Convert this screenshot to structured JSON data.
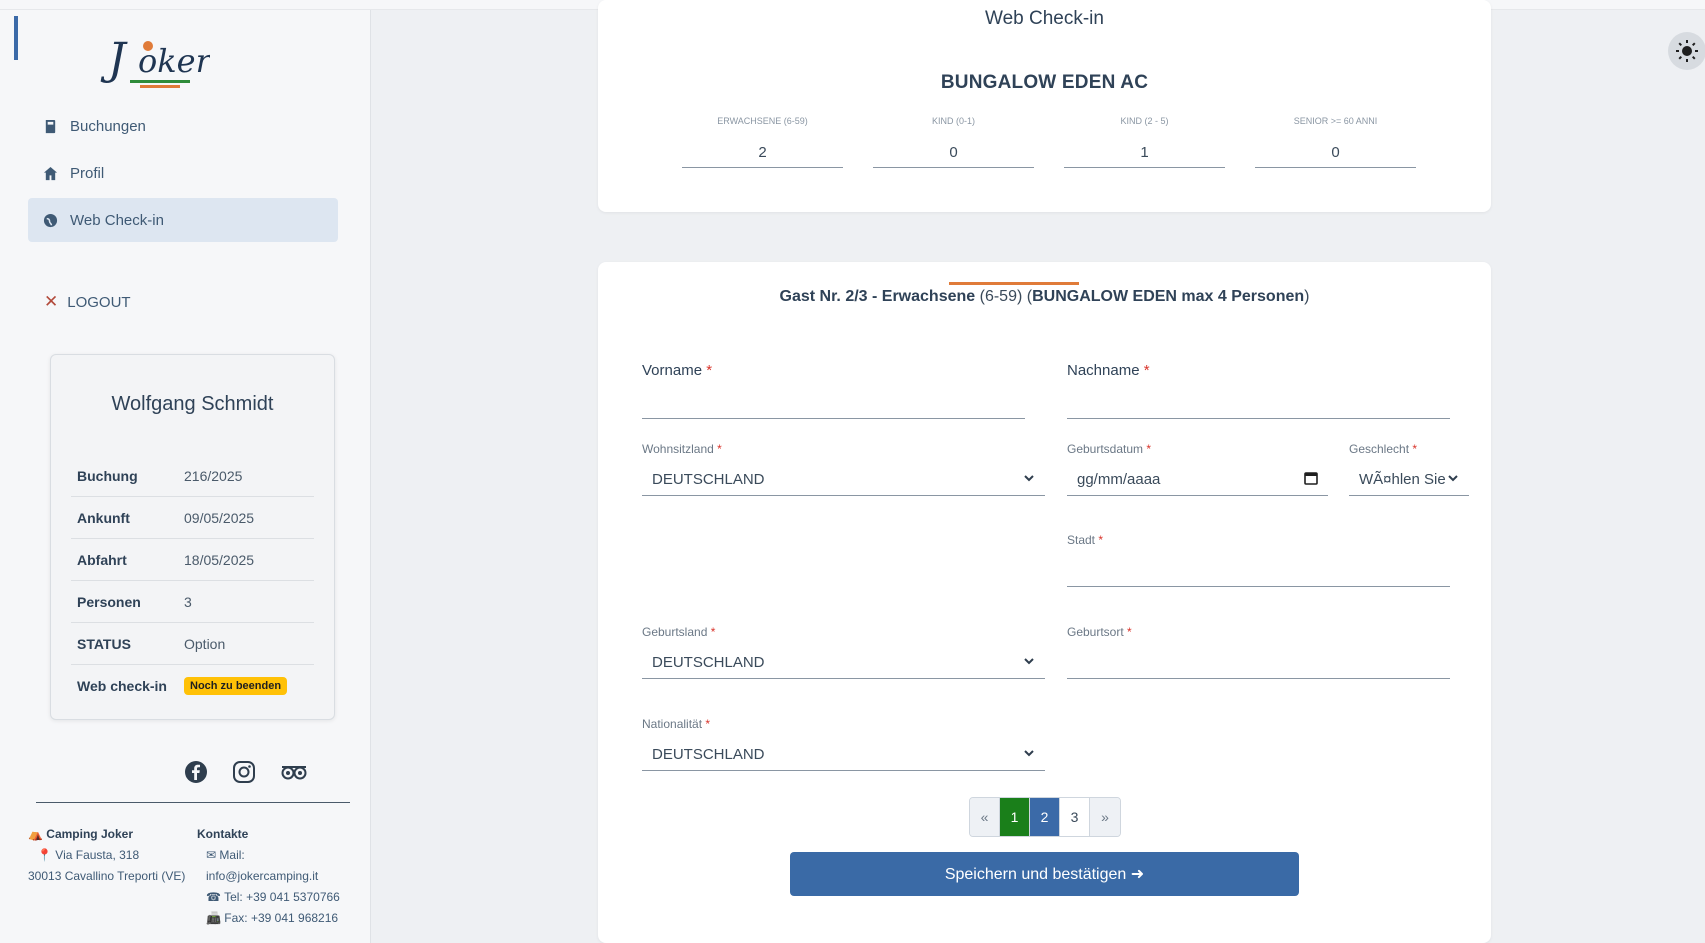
{
  "sidebar": {
    "nav": [
      {
        "label": "Buchungen",
        "icon": "book-icon"
      },
      {
        "label": "Profil",
        "icon": "home-icon"
      },
      {
        "label": "Web Check-in",
        "icon": "globe-icon",
        "active": true
      }
    ],
    "logout": "LOGOUT",
    "guest": {
      "name": "Wolfgang Schmidt",
      "rows": [
        {
          "key": "Buchung",
          "value": "216/2025"
        },
        {
          "key": "Ankunft",
          "value": "09/05/2025"
        },
        {
          "key": "Abfahrt",
          "value": "18/05/2025"
        },
        {
          "key": "Personen",
          "value": "3"
        },
        {
          "key": "STATUS",
          "value": "Option"
        },
        {
          "key": "Web check-in",
          "badge": "Noch zu beenden"
        }
      ]
    },
    "footer": {
      "company": "Camping Joker",
      "address1": "Via Fausta, 318",
      "address2": "30013 Cavallino Treporti (VE)",
      "contacts_title": "Kontakte",
      "mail_label": "Mail:",
      "mail": "info@jokercamping.it",
      "tel": "Tel: +39 041 5370766",
      "fax": "Fax: +39 041 968216"
    }
  },
  "main": {
    "header_title": "Web Check-in",
    "unit": "BUNGALOW EDEN AC",
    "counters": [
      {
        "label": "ERWACHSENE (6-59)",
        "value": "2"
      },
      {
        "label": "KIND (0-1)",
        "value": "0"
      },
      {
        "label": "KIND (2 - 5)",
        "value": "1"
      },
      {
        "label": "SENIOR >= 60 ANNI",
        "value": "0"
      }
    ],
    "form": {
      "title_part1": "Gast Nr. 2/3 - Erwachsene",
      "title_part2": "(6-59)",
      "title_part3": "(",
      "title_part4": "BUNGALOW EDEN max 4 Personen",
      "title_part5": ")",
      "progress": 0.667,
      "vorname_label": "Vorname",
      "nachname_label": "Nachname",
      "wohnsitzland_label": "Wohnsitzland",
      "wohnsitzland_value": "DEUTSCHLAND",
      "geburtsdatum_label": "Geburtsdatum",
      "geburtsdatum_placeholder": "gg/mm/aaaa",
      "geschlecht_label": "Geschlecht",
      "geschlecht_value": "WÃ¤hlen Sie",
      "stadt_label": "Stadt",
      "geburtsland_label": "Geburtsland",
      "geburtsland_value": "DEUTSCHLAND",
      "geburtsort_label": "Geburtsort",
      "nationalitaet_label": "Nationalität",
      "nationalitaet_value": "DEUTSCHLAND",
      "required_mark": "*"
    },
    "pager": {
      "prev": "«",
      "pages": [
        "1",
        "2",
        "3"
      ],
      "next": "»",
      "current": "2"
    },
    "save_button": "Speichern und bestätigen ➜"
  },
  "colors": {
    "accent": "#3a6aa6",
    "badge": "#ffc107",
    "progress": "#e07b39",
    "page_done": "#1a7f1a"
  }
}
